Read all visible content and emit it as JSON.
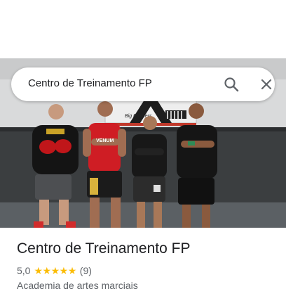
{
  "search": {
    "query": "Centro de Treinamento FP"
  },
  "place": {
    "name": "Centro de Treinamento FP",
    "rating": "5,0",
    "stars": 5,
    "review_count": "(9)",
    "category": "Academia de artes marciais"
  },
  "photo": {
    "banner_text": "Big Brothers",
    "shirt_text": "VENUM",
    "icon": "gym-group-photo"
  },
  "colors": {
    "star": "#fbbc04",
    "title": "#202124",
    "secondary_text": "#5f6368",
    "wall_upper": "#d7d8d9",
    "wall_lower": "#3c3f41",
    "floor": "#5a5f63"
  }
}
